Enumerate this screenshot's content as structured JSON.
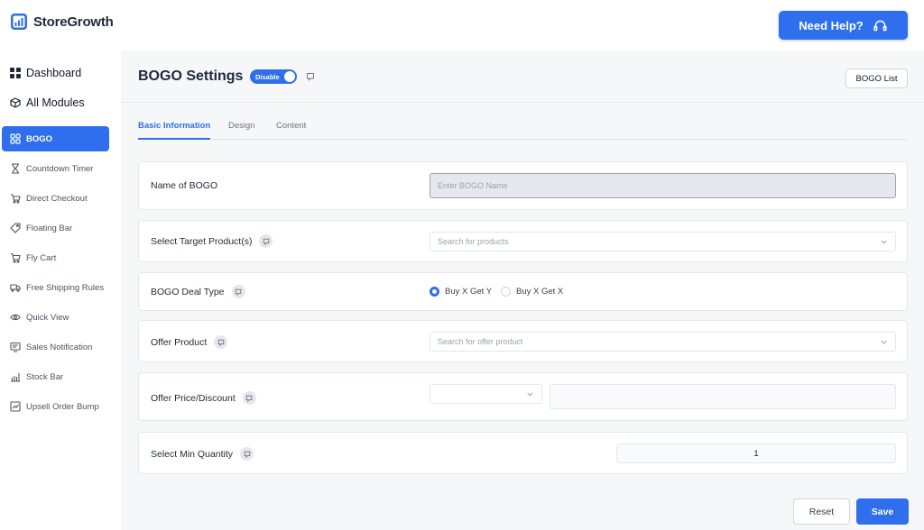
{
  "app": {
    "name": "StoreGrowth"
  },
  "header": {
    "help_label": "Need Help?"
  },
  "sidebar": {
    "top": [
      {
        "label": "Dashboard",
        "icon": "grid-icon"
      },
      {
        "label": "All Modules",
        "icon": "cube-icon"
      }
    ],
    "items": [
      {
        "label": "BOGO",
        "icon": "bogo-icon",
        "active": true
      },
      {
        "label": "Countdown Timer",
        "icon": "hourglass-icon"
      },
      {
        "label": "Direct Checkout",
        "icon": "checkout-icon"
      },
      {
        "label": "Floating Bar",
        "icon": "tag-icon"
      },
      {
        "label": "Fly Cart",
        "icon": "cart-icon"
      },
      {
        "label": "Free Shipping Rules",
        "icon": "truck-icon"
      },
      {
        "label": "Quick View",
        "icon": "eye-icon"
      },
      {
        "label": "Sales Notification",
        "icon": "notification-icon"
      },
      {
        "label": "Stock Bar",
        "icon": "bar-chart-icon"
      },
      {
        "label": "Upsell Order Bump",
        "icon": "trend-icon"
      }
    ]
  },
  "page": {
    "title": "BOGO Settings",
    "toggle_label": "Disable",
    "list_button": "BOGO List",
    "tabs": [
      {
        "label": "Basic Information",
        "active": true
      },
      {
        "label": "Design"
      },
      {
        "label": "Content"
      }
    ]
  },
  "form": {
    "name_label": "Name of BOGO",
    "name_placeholder": "Enter BOGO Name",
    "target_label": "Select Target Product(s)",
    "target_placeholder": "Search for products",
    "deal_label": "BOGO Deal Type",
    "deal_options": [
      {
        "label": "Buy X Get Y",
        "checked": true
      },
      {
        "label": "Buy X Get X",
        "checked": false
      }
    ],
    "offer_label": "Offer Product",
    "offer_placeholder": "Search for offer product",
    "price_label": "Offer Price/Discount",
    "min_qty_label": "Select Min Quantity",
    "min_qty_value": "1"
  },
  "actions": {
    "reset": "Reset",
    "save": "Save"
  },
  "colors": {
    "accent": "#2f6fed"
  }
}
